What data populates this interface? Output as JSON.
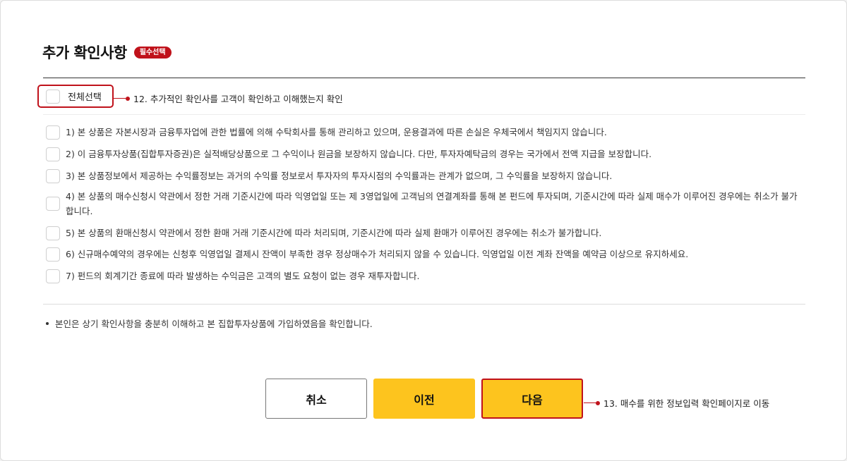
{
  "section": {
    "title": "추가 확인사항",
    "badge": "필수선택"
  },
  "select_all": {
    "label": "전체선택",
    "annotation": "12. 추가적인 확인사를 고객이 확인하고 이해했는지 확인"
  },
  "items": [
    "1) 본 상품은 자본시장과 금융투자업에 관한 법률에 의해 수탁회사를 통해 관리하고 있으며, 운용결과에 따른 손실은 우체국에서 책임지지 않습니다.",
    "2) 이 금융투자상품(집합투자증권)은 실적배당상품으로 그 수익이나 원금을 보장하지 않습니다. 다만, 투자자예탁금의 경우는 국가에서 전액 지급을 보장합니다.",
    "3) 본 상품정보에서 제공하는 수익률정보는 과거의 수익률 정보로서 투자자의 투자시점의 수익률과는 관계가 없으며, 그 수익률을 보장하지 않습니다.",
    "4) 본 상품의 매수신청시 약관에서 정한 거래 기준시간에 따라 익영업일 또는 제 3영업일에 고객님의 연결계좌를 통해 본 펀드에 투자되며, 기준시간에 따라 실제 매수가 이루어진 경우에는 취소가 불가 합니다.",
    "5) 본 상품의 환매신청시 약관에서 정한 환매 거래 기준시간에 따라 처리되며, 기준시간에 따라 실제 환매가 이루어진 경우에는 취소가 불가합니다.",
    "6) 신규매수예약의 경우에는 신청후 익영업일 결제시 잔액이 부족한 경우 정상매수가 처리되지 않을 수 있습니다. 익영업일 이전 계좌 잔액을 예약금 이상으로 유지하세요.",
    "7) 펀드의 회계기간 종료에 따라 발생하는 수익금은 고객의 별도 요청이 없는 경우 재투자합니다."
  ],
  "confirmation": "본인은 상기 확인사항을 충분히 이해하고 본 집합투자상품에 가입하였음을 확인합니다.",
  "buttons": {
    "cancel": "취소",
    "prev": "이전",
    "next": "다음",
    "next_annotation": "13. 매수를 위한 정보입력 확인페이지로 이동"
  },
  "colors": {
    "accent_red": "#c0121b",
    "button_yellow": "#fdc41e"
  }
}
